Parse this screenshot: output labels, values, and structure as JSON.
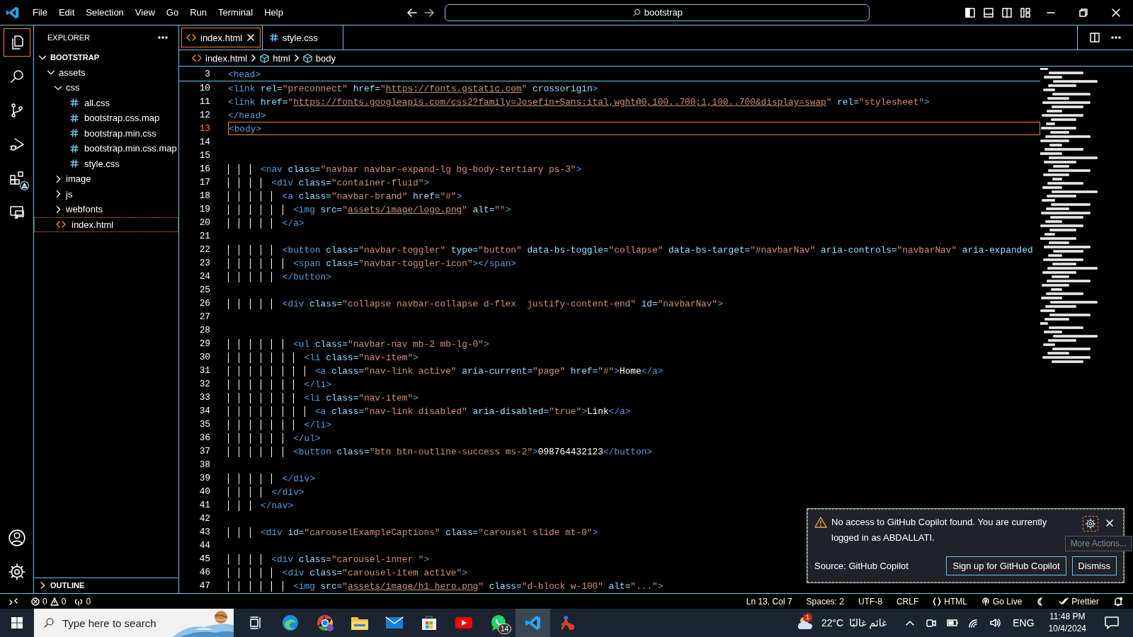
{
  "menu": [
    "File",
    "Edit",
    "Selection",
    "View",
    "Go",
    "Run",
    "Terminal",
    "Help"
  ],
  "command_center": {
    "text": "bootstrap"
  },
  "activity_bar": [
    {
      "kind": "files",
      "selected": true,
      "warning": false
    },
    {
      "kind": "search",
      "selected": false,
      "warning": false
    },
    {
      "kind": "branch",
      "selected": false,
      "warning": false
    },
    {
      "kind": "run",
      "selected": false,
      "warning": false
    },
    {
      "kind": "extensions",
      "selected": false,
      "warning": true
    },
    {
      "kind": "remote",
      "selected": false,
      "warning": false
    }
  ],
  "activity_bar_bottom": [
    {
      "kind": "account"
    },
    {
      "kind": "settings"
    }
  ],
  "explorer": {
    "title": "EXPLORER",
    "folder": "BOOTSTRAP",
    "expanded": true,
    "tree": [
      {
        "label": "assets",
        "kind": "folder",
        "expanded": true,
        "selected": false,
        "children": [
          {
            "label": "css",
            "kind": "folder",
            "expanded": true,
            "selected": false,
            "children": [
              {
                "label": "all.css",
                "kind": "css",
                "selected": false
              },
              {
                "label": "bootstrap.css.map",
                "kind": "css",
                "selected": false
              },
              {
                "label": "bootstrap.min.css",
                "kind": "css",
                "selected": false
              },
              {
                "label": "bootstrap.min.css.map",
                "kind": "css",
                "selected": false
              },
              {
                "label": "style.css",
                "kind": "css",
                "selected": false
              }
            ]
          },
          {
            "label": "image",
            "kind": "folder",
            "expanded": false,
            "selected": false
          },
          {
            "label": "js",
            "kind": "folder",
            "expanded": false,
            "selected": false
          },
          {
            "label": "webfonts",
            "kind": "folder",
            "expanded": false,
            "selected": false
          }
        ]
      },
      {
        "label": "index.html",
        "kind": "html",
        "selected": true
      }
    ],
    "outline": {
      "title": "OUTLINE",
      "expanded": false
    }
  },
  "tabs": [
    {
      "label": "index.html",
      "kind": "html",
      "selected": true
    },
    {
      "label": "style.css",
      "kind": "css",
      "selected": false
    }
  ],
  "breadcrumbs": [
    {
      "label": "index.html",
      "kind": "html"
    },
    {
      "label": "html",
      "kind": "element"
    },
    {
      "label": "body",
      "kind": "element"
    }
  ],
  "sticky_line": {
    "number": "3",
    "tokens": [
      {
        "kind": "tag",
        "text": "<head>"
      }
    ]
  },
  "code_lines": [
    {
      "number": "10",
      "current": false,
      "tokens": [
        {
          "kind": "tag",
          "text": "<link"
        },
        {
          "kind": "attr",
          "text": " rel="
        },
        {
          "kind": "str",
          "text": "\"preconnect\""
        },
        {
          "kind": "attr",
          "text": " href="
        },
        {
          "kind": "str",
          "text": "\""
        },
        {
          "kind": "link",
          "text": "https://fonts.gstatic.com"
        },
        {
          "kind": "str",
          "text": "\""
        },
        {
          "kind": "attr",
          "text": " crossorigin"
        },
        {
          "kind": "tag",
          "text": ">"
        }
      ]
    },
    {
      "number": "11",
      "current": false,
      "tokens": [
        {
          "kind": "tag",
          "text": "<link"
        },
        {
          "kind": "attr",
          "text": " href="
        },
        {
          "kind": "str",
          "text": "\""
        },
        {
          "kind": "link",
          "text": "https://fonts.googleapis.com/css2?family=Josefin+Sans:ital,wght@0,100..700;1,100..700&display=swap"
        },
        {
          "kind": "str",
          "text": "\""
        },
        {
          "kind": "attr",
          "text": " rel="
        },
        {
          "kind": "str",
          "text": "\"stylesheet\""
        },
        {
          "kind": "tag",
          "text": ">"
        }
      ]
    },
    {
      "number": "12",
      "current": false,
      "tokens": [
        {
          "kind": "tag",
          "text": "</head>"
        }
      ]
    },
    {
      "number": "13",
      "current": true,
      "tokens": [
        {
          "kind": "tag",
          "text": "<body>"
        }
      ]
    },
    {
      "number": "14",
      "current": false
    },
    {
      "number": "15",
      "current": false
    },
    {
      "number": "16",
      "current": false,
      "tokens": [
        {
          "kind": "tag",
          "text": "      <nav"
        },
        {
          "kind": "attr",
          "text": " class="
        },
        {
          "kind": "str",
          "text": "\"navbar navbar-expand-lg bg-body-tertiary ps-3\""
        },
        {
          "kind": "tag",
          "text": ">"
        }
      ]
    },
    {
      "number": "17",
      "current": false,
      "tokens": [
        {
          "kind": "tag",
          "text": "        <div"
        },
        {
          "kind": "attr",
          "text": " class="
        },
        {
          "kind": "str",
          "text": "\"container-fluid\""
        },
        {
          "kind": "tag",
          "text": ">"
        }
      ]
    },
    {
      "number": "18",
      "current": false,
      "tokens": [
        {
          "kind": "tag",
          "text": "          <a"
        },
        {
          "kind": "attr",
          "text": " class="
        },
        {
          "kind": "str",
          "text": "\"navbar-brand\""
        },
        {
          "kind": "attr",
          "text": " href="
        },
        {
          "kind": "str",
          "text": "\"#\""
        },
        {
          "kind": "tag",
          "text": ">"
        }
      ]
    },
    {
      "number": "19",
      "current": false,
      "tokens": [
        {
          "kind": "tag",
          "text": "            <img"
        },
        {
          "kind": "attr",
          "text": " src="
        },
        {
          "kind": "str",
          "text": "\""
        },
        {
          "kind": "link",
          "text": "assets/image/logo.png"
        },
        {
          "kind": "str",
          "text": "\""
        },
        {
          "kind": "attr",
          "text": " alt="
        },
        {
          "kind": "str",
          "text": "\"\""
        },
        {
          "kind": "tag",
          "text": ">"
        }
      ]
    },
    {
      "number": "20",
      "current": false,
      "tokens": [
        {
          "kind": "tag",
          "text": "          </a>"
        }
      ]
    },
    {
      "number": "21",
      "current": false
    },
    {
      "number": "22",
      "current": false,
      "tokens": [
        {
          "kind": "tag",
          "text": "          <button"
        },
        {
          "kind": "attr",
          "text": " class="
        },
        {
          "kind": "str",
          "text": "\"navbar-toggler\""
        },
        {
          "kind": "attr",
          "text": " type="
        },
        {
          "kind": "str",
          "text": "\"button\""
        },
        {
          "kind": "attr",
          "text": " data-bs-toggle="
        },
        {
          "kind": "str",
          "text": "\"collapse\""
        },
        {
          "kind": "attr",
          "text": " data-bs-target="
        },
        {
          "kind": "str",
          "text": "\"#navbarNav\""
        },
        {
          "kind": "attr",
          "text": " aria-controls="
        },
        {
          "kind": "str",
          "text": "\"navbarNav\""
        },
        {
          "kind": "attr",
          "text": " aria-expanded"
        }
      ]
    },
    {
      "number": "23",
      "current": false,
      "tokens": [
        {
          "kind": "tag",
          "text": "            <span"
        },
        {
          "kind": "attr",
          "text": " class="
        },
        {
          "kind": "str",
          "text": "\"navbar-toggler-icon\""
        },
        {
          "kind": "tag",
          "text": "></span>"
        }
      ]
    },
    {
      "number": "24",
      "current": false,
      "tokens": [
        {
          "kind": "tag",
          "text": "          </button>"
        }
      ]
    },
    {
      "number": "25",
      "current": false
    },
    {
      "number": "26",
      "current": false,
      "tokens": [
        {
          "kind": "tag",
          "text": "          <div"
        },
        {
          "kind": "attr",
          "text": " class="
        },
        {
          "kind": "str",
          "text": "\"collapse navbar-collapse d-flex  justify-content-end\""
        },
        {
          "kind": "attr",
          "text": " id="
        },
        {
          "kind": "str",
          "text": "\"navbarNav\""
        },
        {
          "kind": "tag",
          "text": ">"
        }
      ]
    },
    {
      "number": "27",
      "current": false
    },
    {
      "number": "28",
      "current": false
    },
    {
      "number": "29",
      "current": false,
      "tokens": [
        {
          "kind": "tag",
          "text": "            <ul"
        },
        {
          "kind": "attr",
          "text": " class="
        },
        {
          "kind": "str",
          "text": "\"navbar-nav mb-2 mb-lg-0\""
        },
        {
          "kind": "tag",
          "text": ">"
        }
      ]
    },
    {
      "number": "30",
      "current": false,
      "tokens": [
        {
          "kind": "tag",
          "text": "              <li"
        },
        {
          "kind": "attr",
          "text": " class="
        },
        {
          "kind": "str",
          "text": "\"nav-item\""
        },
        {
          "kind": "tag",
          "text": ">"
        }
      ]
    },
    {
      "number": "31",
      "current": false,
      "tokens": [
        {
          "kind": "tag",
          "text": "                <a"
        },
        {
          "kind": "attr",
          "text": " class="
        },
        {
          "kind": "str",
          "text": "\"nav-link active\""
        },
        {
          "kind": "attr",
          "text": " aria-current="
        },
        {
          "kind": "str",
          "text": "\"page\""
        },
        {
          "kind": "attr",
          "text": " href="
        },
        {
          "kind": "str",
          "text": "\"#\""
        },
        {
          "kind": "tag",
          "text": ">"
        },
        {
          "kind": "text",
          "text": "Home"
        },
        {
          "kind": "tag",
          "text": "</a>"
        }
      ]
    },
    {
      "number": "32",
      "current": false,
      "tokens": [
        {
          "kind": "tag",
          "text": "              </li>"
        }
      ]
    },
    {
      "number": "33",
      "current": false,
      "tokens": [
        {
          "kind": "tag",
          "text": "              <li"
        },
        {
          "kind": "attr",
          "text": " class="
        },
        {
          "kind": "str",
          "text": "\"nav-item\""
        },
        {
          "kind": "tag",
          "text": ">"
        }
      ]
    },
    {
      "number": "34",
      "current": false,
      "tokens": [
        {
          "kind": "tag",
          "text": "                <a"
        },
        {
          "kind": "attr",
          "text": " class="
        },
        {
          "kind": "str",
          "text": "\"nav-link disabled\""
        },
        {
          "kind": "attr",
          "text": " aria-disabled="
        },
        {
          "kind": "str",
          "text": "\"true\""
        },
        {
          "kind": "tag",
          "text": ">"
        },
        {
          "kind": "text",
          "text": "Link"
        },
        {
          "kind": "tag",
          "text": "</a>"
        }
      ]
    },
    {
      "number": "35",
      "current": false,
      "tokens": [
        {
          "kind": "tag",
          "text": "              </li>"
        }
      ]
    },
    {
      "number": "36",
      "current": false,
      "tokens": [
        {
          "kind": "tag",
          "text": "            </ul>"
        }
      ]
    },
    {
      "number": "37",
      "current": false,
      "tokens": [
        {
          "kind": "tag",
          "text": "            <button"
        },
        {
          "kind": "attr",
          "text": " class="
        },
        {
          "kind": "str",
          "text": "\"btn btn-outline-success ms-2\""
        },
        {
          "kind": "tag",
          "text": ">"
        },
        {
          "kind": "text",
          "text": "098764432123"
        },
        {
          "kind": "tag",
          "text": "</button>"
        }
      ]
    },
    {
      "number": "38",
      "current": false
    },
    {
      "number": "39",
      "current": false,
      "tokens": [
        {
          "kind": "tag",
          "text": "          </div>"
        }
      ]
    },
    {
      "number": "40",
      "current": false,
      "tokens": [
        {
          "kind": "tag",
          "text": "        </div>"
        }
      ]
    },
    {
      "number": "41",
      "current": false,
      "tokens": [
        {
          "kind": "tag",
          "text": "      </nav>"
        }
      ]
    },
    {
      "number": "42",
      "current": false
    },
    {
      "number": "43",
      "current": false,
      "tokens": [
        {
          "kind": "tag",
          "text": "      <div"
        },
        {
          "kind": "attr",
          "text": " id="
        },
        {
          "kind": "str",
          "text": "\"carouselExampleCaptions\""
        },
        {
          "kind": "attr",
          "text": " class="
        },
        {
          "kind": "str",
          "text": "\"carousel slide mt-0\""
        },
        {
          "kind": "tag",
          "text": ">"
        }
      ]
    },
    {
      "number": "44",
      "current": false
    },
    {
      "number": "45",
      "current": false,
      "tokens": [
        {
          "kind": "tag",
          "text": "        <div"
        },
        {
          "kind": "attr",
          "text": " class="
        },
        {
          "kind": "str",
          "text": "\"carousel-inner \""
        },
        {
          "kind": "tag",
          "text": ">"
        }
      ]
    },
    {
      "number": "46",
      "current": false,
      "tokens": [
        {
          "kind": "tag",
          "text": "          <div"
        },
        {
          "kind": "attr",
          "text": " class="
        },
        {
          "kind": "str",
          "text": "\"carousel-item active\""
        },
        {
          "kind": "tag",
          "text": ">"
        }
      ]
    },
    {
      "number": "47",
      "current": false,
      "tokens": [
        {
          "kind": "tag",
          "text": "            <img"
        },
        {
          "kind": "attr",
          "text": " src="
        },
        {
          "kind": "str",
          "text": "\""
        },
        {
          "kind": "link",
          "text": "assets/image/h1_hero.png"
        },
        {
          "kind": "str",
          "text": "\""
        },
        {
          "kind": "attr",
          "text": " class="
        },
        {
          "kind": "str",
          "text": "\"d-block w-100\""
        },
        {
          "kind": "attr",
          "text": " alt="
        },
        {
          "kind": "str",
          "text": "\"...\""
        },
        {
          "kind": "tag",
          "text": ">"
        }
      ]
    }
  ],
  "notification": {
    "message": "No access to GitHub Copilot found. You are currently logged in as ABDALLATI.",
    "source": "Source: GitHub Copilot",
    "tooltip": "More Actions...",
    "buttons": [
      "Sign up for GitHub Copilot",
      "Dismiss"
    ]
  },
  "status_bar": {
    "errors": "0",
    "warnings": "0",
    "ports": "0",
    "right": [
      {
        "kind": "text",
        "text": "Ln 13, Col 7"
      },
      {
        "kind": "text",
        "text": "Spaces: 2"
      },
      {
        "kind": "text",
        "text": "UTF-8"
      },
      {
        "kind": "text",
        "text": "CRLF"
      },
      {
        "kind": "language",
        "text": "HTML"
      },
      {
        "kind": "live",
        "text": "Go Live"
      },
      {
        "kind": "theme"
      },
      {
        "kind": "formatter",
        "text": "Prettier"
      },
      {
        "kind": "notifications"
      }
    ]
  },
  "taskbar": {
    "search_placeholder": "Type here to search",
    "apps": [
      {
        "kind": "task-view",
        "selected": false
      },
      {
        "kind": "edge",
        "selected": false
      },
      {
        "kind": "chrome",
        "selected": false
      },
      {
        "kind": "folder",
        "selected": false
      },
      {
        "kind": "mail",
        "selected": false
      },
      {
        "kind": "store",
        "selected": false
      },
      {
        "kind": "youtube",
        "selected": false
      },
      {
        "kind": "whatsapp",
        "selected": false,
        "badge": "14"
      },
      {
        "kind": "vscode",
        "selected": true
      },
      {
        "kind": "app",
        "selected": false
      }
    ],
    "weather_badge": "1",
    "temperature": "22°C",
    "weather": "غائم غالبًا",
    "language": "ENG",
    "time": "11:48 PM",
    "date": "10/4/2024"
  }
}
